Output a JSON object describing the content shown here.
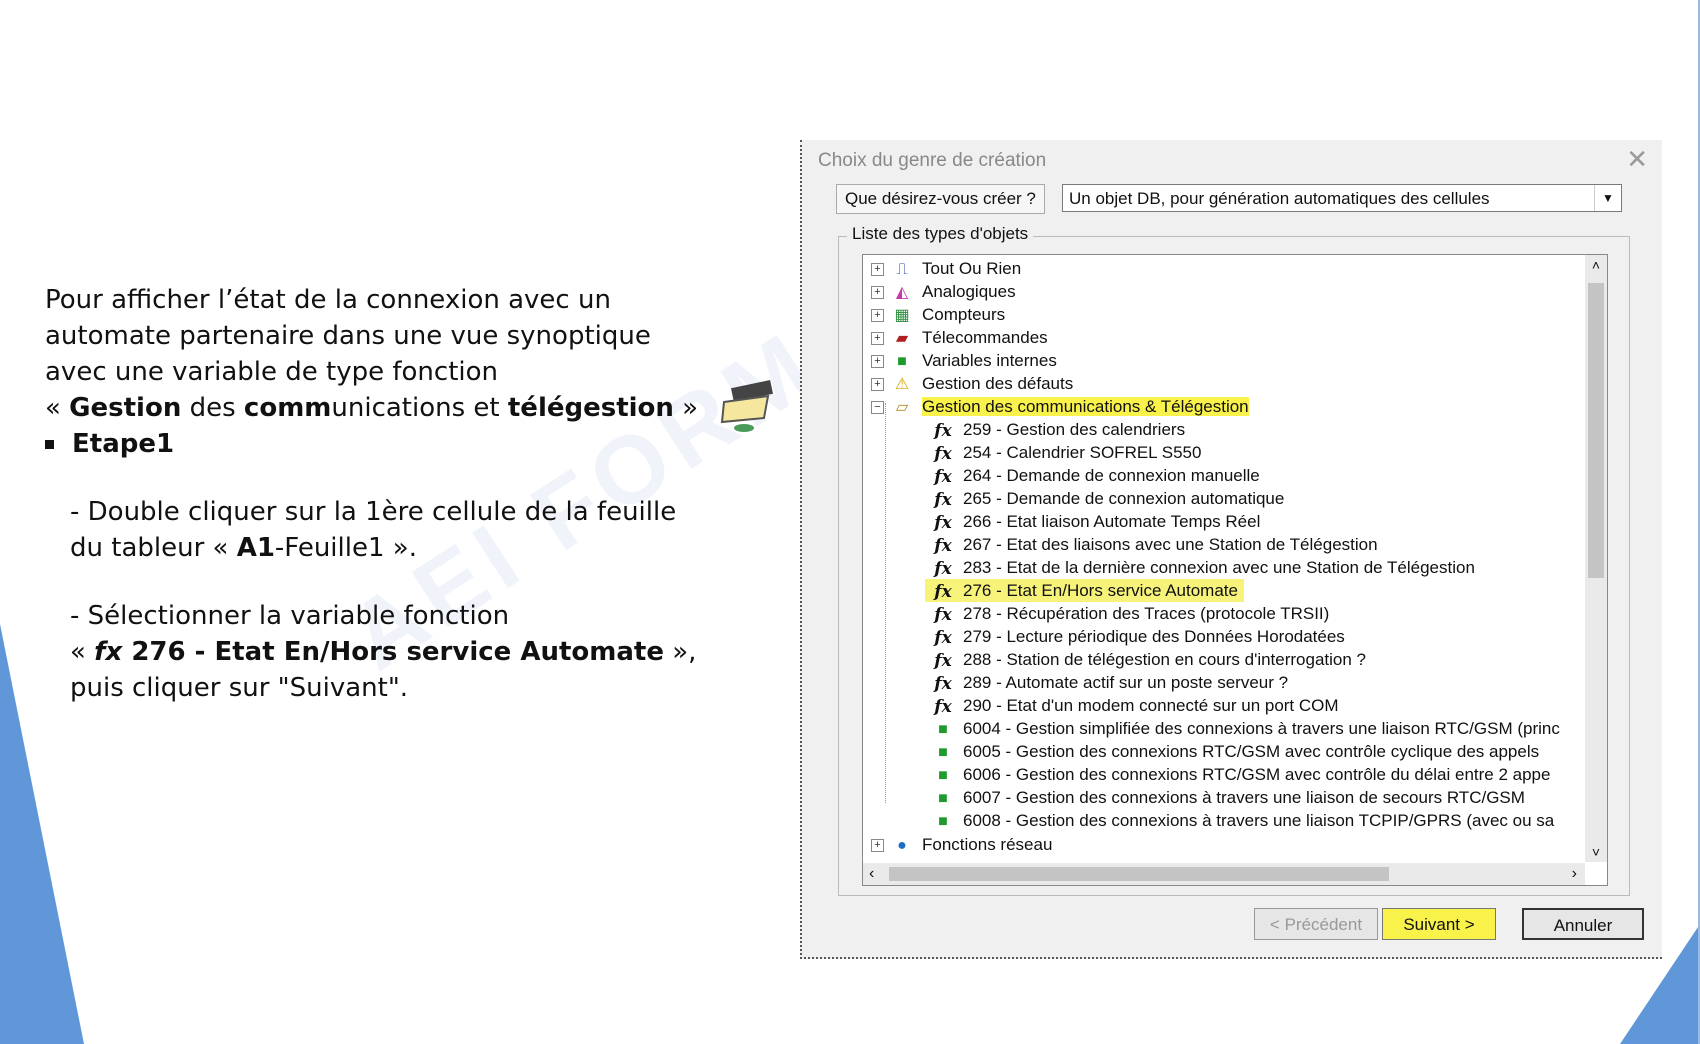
{
  "slide": {
    "intro_line1": "Pour afficher l’état de la connexion avec un",
    "intro_line2": "automate partenaire dans une vue synoptique",
    "intro_line3": "avec une variable de type fonction",
    "intro_q_open": " « ",
    "intro_b1": "Gestion",
    "intro_t1": " des ",
    "intro_b2": "comm",
    "intro_t2": "unications et ",
    "intro_b3": "télégestion",
    "intro_q_close": " »",
    "bullet": "Etape1",
    "step1_line1": "- Double cliquer sur la 1ère cellule de la feuille",
    "step1_line2_pre": "du tableur « ",
    "step1_line2_bold": "A1",
    "step1_line2_post": "-Feuille1 ».",
    "step2_line1": "- Sélectionner la variable fonction",
    "step2_line2_pre": "« ",
    "step2_fx": "fx",
    "step2_line2_bold": " 276 - Etat En/Hors service Automate",
    "step2_line2_post": " »,",
    "step2_line3": " puis cliquer sur \"Suivant\".",
    "watermark": "AEI FORMA"
  },
  "dialog": {
    "title": "Choix du genre de création",
    "close": "✕",
    "question_label": "Que désirez-vous créer ?",
    "dropdown_value": "Un objet DB, pour génération automatiques des cellules",
    "group_title": "Liste des types d'objets",
    "tree": {
      "top_items": [
        {
          "label": "Tout Ou Rien",
          "icon": "signal-wave-icon"
        },
        {
          "label": "Analogiques",
          "icon": "analog-chart-icon"
        },
        {
          "label": "Compteurs",
          "icon": "counter-icon"
        },
        {
          "label": "Télecommandes",
          "icon": "remote-command-icon"
        },
        {
          "label": "Variables internes",
          "icon": "internal-variable-icon"
        },
        {
          "label": "Gestion des défauts",
          "icon": "warning-icon"
        }
      ],
      "expanded": {
        "label": "Gestion des communications & Télégestion",
        "icon": "communication-icon"
      },
      "children": [
        "259 - Gestion des calendriers",
        "254 - Calendrier SOFREL S550",
        "264 - Demande de connexion manuelle",
        "265 - Demande de connexion automatique",
        "266 - Etat liaison Automate Temps Réel",
        "267 - Etat des liaisons avec une Station de Télégestion",
        "283 - Etat de la dernière connexion avec une Station de Télégestion",
        "276 - Etat En/Hors service Automate",
        "278 - Récupération des Traces (protocole TRSII)",
        "279 - Lecture périodique des Données Horodatées",
        "288 - Station de télégestion en cours d'interrogation ?",
        "289 - Automate actif sur un poste serveur ?",
        "290 - Etat d'un modem connecté sur un port COM"
      ],
      "cube_children": [
        "6004 - Gestion simplifiée des connexions à travers une liaison RTC/GSM (princ",
        "6005 - Gestion des connexions RTC/GSM avec contrôle cyclique des appels",
        "6006 - Gestion des connexions RTC/GSM avec contrôle du délai entre 2 appe",
        "6007 - Gestion des connexions à travers une liaison de secours RTC/GSM",
        "6008 - Gestion des connexions à travers une liaison TCPIP/GPRS (avec ou sa"
      ],
      "last_item": {
        "label": "Fonctions réseau",
        "icon": "globe-icon"
      },
      "fx_glyph": "fx",
      "selected_index": 7
    },
    "buttons": {
      "prev": "< Précédent",
      "next": "Suivant >",
      "cancel": "Annuler"
    }
  },
  "colors": {
    "highlight": "#f8f24a",
    "accent_blue": "#5f97d8"
  }
}
